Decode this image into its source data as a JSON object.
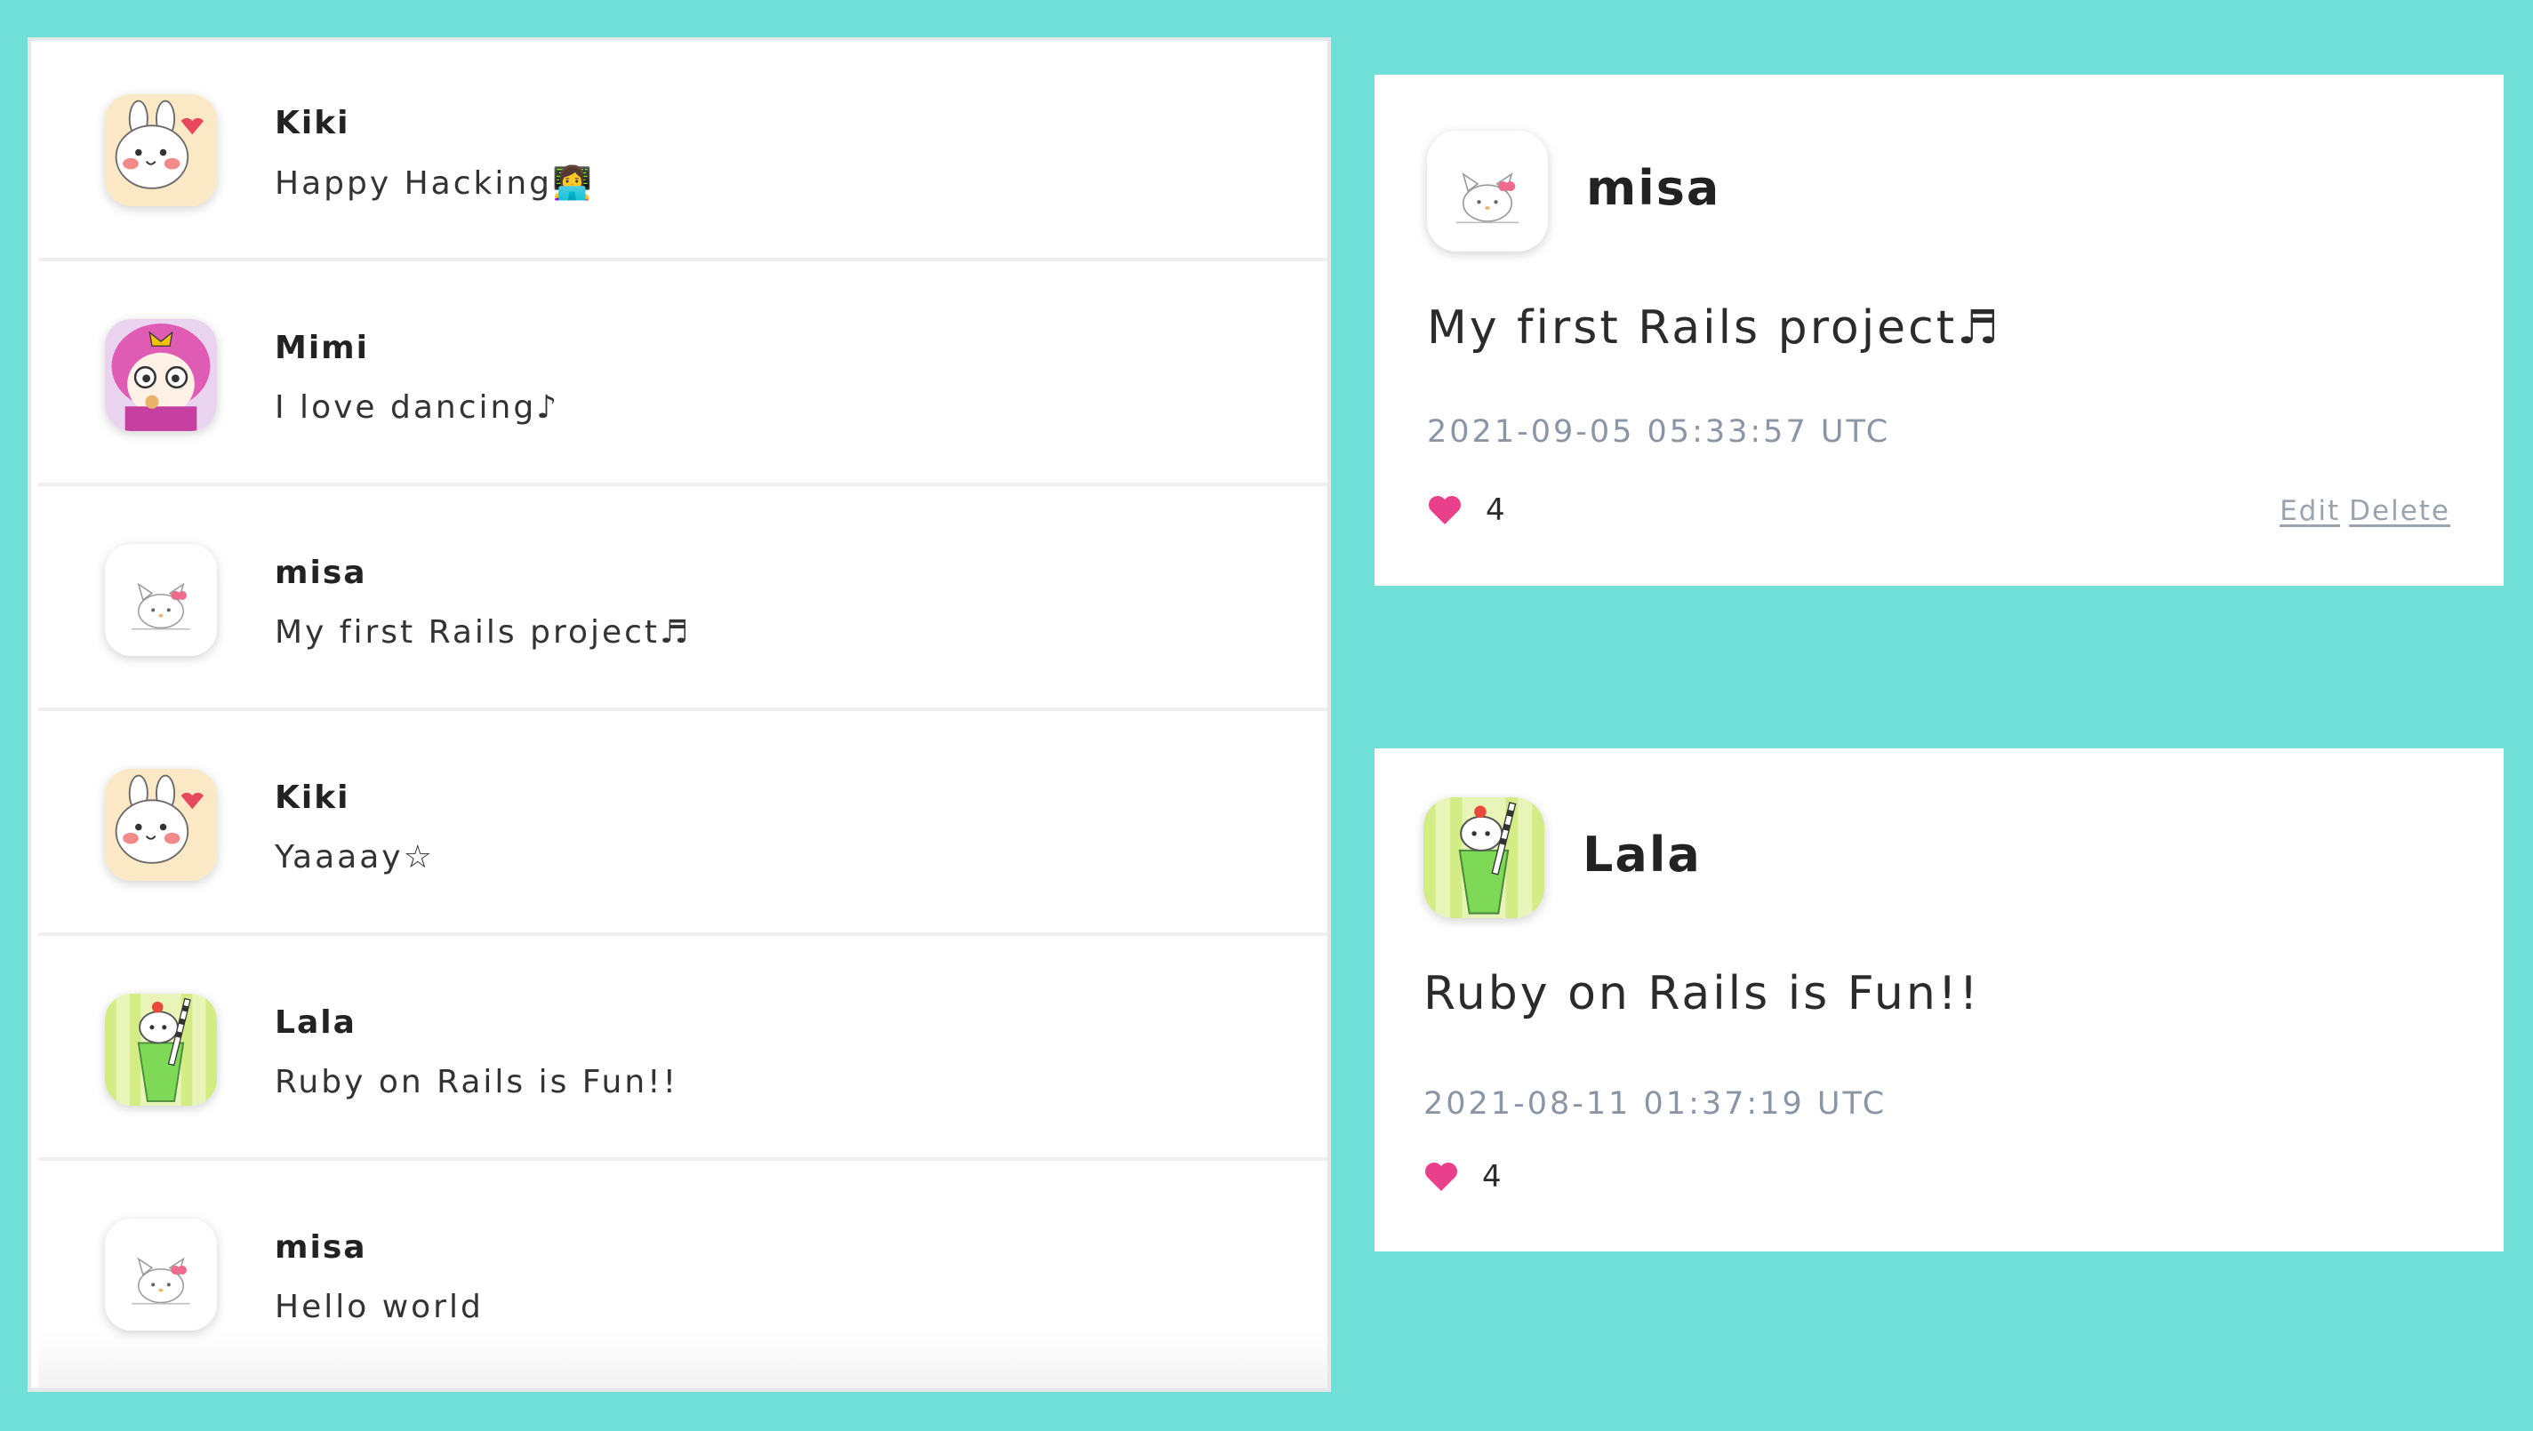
{
  "feed": {
    "posts": [
      {
        "user": "Kiki",
        "content": "Happy Hacking👩‍💻",
        "avatar_icon": "bunny-avatar-icon"
      },
      {
        "user": "Mimi",
        "content": "I love dancing♪",
        "avatar_icon": "pink-hair-avatar-icon"
      },
      {
        "user": "misa",
        "content": "My first Rails project♬",
        "avatar_icon": "kitty-avatar-icon"
      },
      {
        "user": "Kiki",
        "content": "Yaaaay☆",
        "avatar_icon": "bunny-avatar-icon"
      },
      {
        "user": "Lala",
        "content": "Ruby on Rails is Fun!!",
        "avatar_icon": "melon-soda-avatar-icon"
      },
      {
        "user": "misa",
        "content": "Hello world",
        "avatar_icon": "kitty-avatar-icon"
      }
    ]
  },
  "details": [
    {
      "user": "misa",
      "content": "My first Rails project♬",
      "created_at": "2021-09-05 05:33:57 UTC",
      "likes": "4",
      "edit_label": "Edit",
      "delete_label": "Delete",
      "avatar_icon": "kitty-avatar-icon"
    },
    {
      "user": "Lala",
      "content": "Ruby on Rails is Fun!!",
      "created_at": "2021-08-11 01:37:19 UTC",
      "likes": "4",
      "avatar_icon": "melon-soda-avatar-icon"
    }
  ],
  "colors": {
    "background": "#6fdfd8",
    "heart": "#ea3f8b",
    "muted_text": "#8a95a5"
  }
}
